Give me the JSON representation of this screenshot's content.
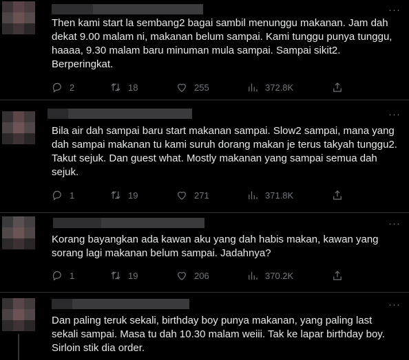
{
  "tweets": [
    {
      "text": "Then kami start la sembang2 bagai sambil menunggu makanan. Jam dah dekat 9.00 malam ni, makanan belum sampai. Kami tunggu punya tunggu, haaaa, 9.30 malam baru minuman mula sampai. Sampai sikit2. Berperingkat.",
      "replies": "2",
      "retweets": "18",
      "likes": "255",
      "views": "372.8K"
    },
    {
      "text": "Bila air dah sampai baru start makanan sampai. Slow2 sampai, mana yang dah sampai makanan tu kami suruh dorang makan je terus takyah tunggu2. Takut sejuk. Dan guest what. Mostly makanan yang sampai semua dah sejuk.",
      "replies": "1",
      "retweets": "19",
      "likes": "271",
      "views": "371.8K"
    },
    {
      "text": "Korang bayangkan ada kawan aku yang dah habis makan, kawan yang sorang lagi makanan belum sampai. Jadahnya?",
      "replies": "1",
      "retweets": "19",
      "likes": "206",
      "views": "370.2K"
    },
    {
      "text": "Dan paling teruk sekali, birthday boy punya makanan, yang paling last sekali sampai. Masa tu dah 10.30 malam weiii. Tak ke lapar birthday boy. Sirloin stik dia order."
    }
  ],
  "icons": {
    "reply": "reply-icon",
    "retweet": "retweet-icon",
    "like": "heart-icon",
    "views": "views-icon",
    "share": "share-icon",
    "more": "more-icon"
  },
  "colors": {
    "background": "#000000",
    "text": "#e7e9ea",
    "muted": "#71767b",
    "divider": "#2f3336"
  }
}
